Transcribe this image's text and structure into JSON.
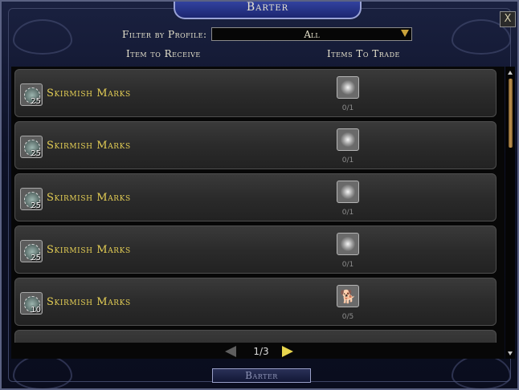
{
  "window": {
    "title": "Barter",
    "close_label": "X"
  },
  "filter": {
    "label": "Filter by Profile:",
    "value": "All"
  },
  "columns": {
    "receive": "Item to Receive",
    "trade": "Items To Trade"
  },
  "rows": [
    {
      "name": "Skirmish Marks",
      "quantity": "25",
      "trade_count": "0/1",
      "trade_icon": "silver-ring-icon"
    },
    {
      "name": "Skirmish Marks",
      "quantity": "25",
      "trade_count": "0/1",
      "trade_icon": "silver-ring-icon"
    },
    {
      "name": "Skirmish Marks",
      "quantity": "25",
      "trade_count": "0/1",
      "trade_icon": "silver-ring-icon"
    },
    {
      "name": "Skirmish Marks",
      "quantity": "25",
      "trade_count": "0/1",
      "trade_icon": "silver-ring-icon"
    },
    {
      "name": "Skirmish Marks",
      "quantity": "10",
      "trade_count": "0/5",
      "trade_icon": "wolf-icon"
    }
  ],
  "pager": {
    "label": "1/3"
  },
  "footer": {
    "barter_label": "Barter"
  },
  "colors": {
    "accent": "#e5cf55",
    "frame": "#1c2670"
  }
}
